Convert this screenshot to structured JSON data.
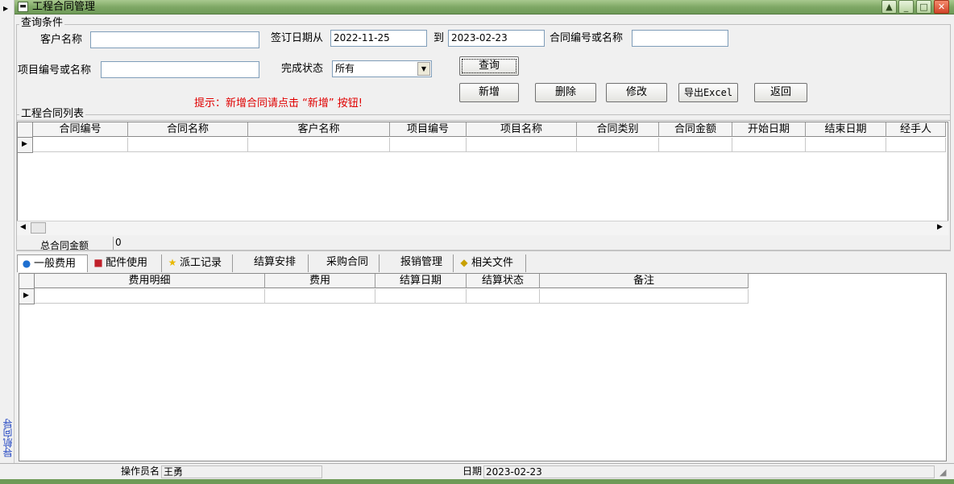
{
  "window": {
    "title": "工程合同管理",
    "min_label": "_",
    "max_label": "□",
    "close_label": "✕",
    "restore_label": "▲"
  },
  "nav": {
    "label": "导航向导",
    "arrow": "▶"
  },
  "query": {
    "group_title": "查询条件",
    "customer_label": "客户名称",
    "customer_value": "",
    "sign_date_label": "签订日期从",
    "date_from": "2022-11-25",
    "to_label": "到",
    "date_to": "2023-02-23",
    "contract_label": "合同编号或名称",
    "contract_value": "",
    "project_label": "项目编号或名称",
    "project_value": "",
    "status_label": "完成状态",
    "status_value": "所有",
    "search_btn": "查询"
  },
  "hint": "提示：新增合同请点击 “新增” 按钮!",
  "actions": {
    "add": "新增",
    "delete": "删除",
    "edit": "修改",
    "export": "导出Excel",
    "back": "返回"
  },
  "contract_list": {
    "group_title": "工程合同列表",
    "columns": [
      "合同编号",
      "合同名称",
      "客户名称",
      "项目编号",
      "项目名称",
      "合同类别",
      "合同金额",
      "开始日期",
      "结束日期",
      "经手人"
    ],
    "total_label": "总合同金额",
    "total_value": "0"
  },
  "tabs": [
    {
      "label": "一般费用",
      "icon": "globe-icon",
      "glyph": "●"
    },
    {
      "label": "配件使用",
      "icon": "box-icon",
      "glyph": "■"
    },
    {
      "label": "派工记录",
      "icon": "star-icon",
      "glyph": "★"
    },
    {
      "label": "结算安排",
      "icon": "",
      "glyph": ""
    },
    {
      "label": "采购合同",
      "icon": "",
      "glyph": ""
    },
    {
      "label": "报销管理",
      "icon": "",
      "glyph": ""
    },
    {
      "label": "相关文件",
      "icon": "cube-icon",
      "glyph": "◆"
    }
  ],
  "fee_grid": {
    "columns": [
      "费用明细",
      "费用",
      "结算日期",
      "结算状态",
      "备注"
    ]
  },
  "status_bar": {
    "operator_label": "操作员名",
    "operator_value": "王勇",
    "date_label": "日期",
    "date_value": "2023-02-23"
  },
  "colors": {
    "hint": "#e00000",
    "titlebar": "#7fa866",
    "nav_label": "#1a3fc0"
  }
}
